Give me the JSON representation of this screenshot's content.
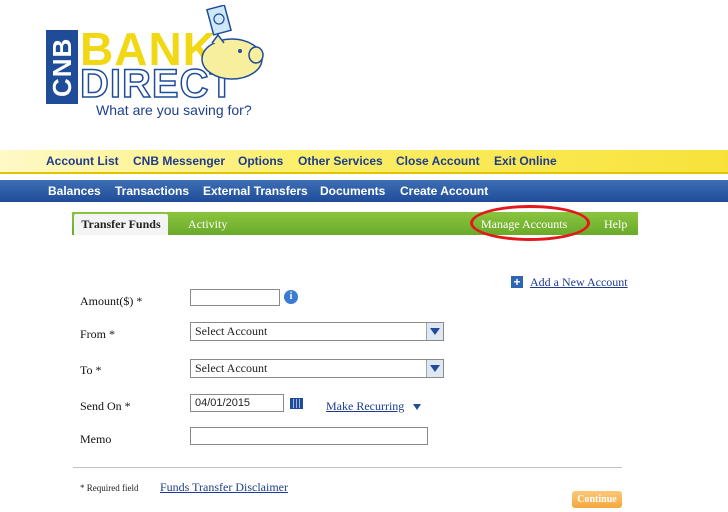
{
  "logo": {
    "cnb": "CNB",
    "bank": "BANK",
    "direct": "DIRECT",
    "tagline": "What are you saving for?"
  },
  "top_nav": [
    "Account List",
    "CNB Messenger",
    "Options",
    "Other Services",
    "Close Account",
    "Exit Online"
  ],
  "sub_nav": [
    "Balances",
    "Transactions",
    "External Transfers",
    "Documents",
    "Create Account"
  ],
  "tabs": {
    "transfer_funds": "Transfer Funds",
    "activity": "Activity",
    "manage_accounts": "Manage Accounts",
    "help": "Help"
  },
  "form": {
    "add_account_link": "Add a New Account",
    "amount_label": "Amount($) *",
    "amount_value": "",
    "from_label": "From *",
    "from_value": "Select Account",
    "to_label": "To *",
    "to_value": "Select Account",
    "send_on_label": "Send On *",
    "send_on_value": "04/01/2015",
    "make_recurring": "Make Recurring",
    "memo_label": "Memo",
    "memo_value": ""
  },
  "footer": {
    "required_note": "* Required field",
    "disclaimer_link": "Funds Transfer Disclaimer",
    "continue_label": "Continue"
  },
  "colors": {
    "nav_blue": "#1f4c99",
    "nav_yellow": "#f8e23a",
    "tab_green": "#7ab834",
    "highlight_red": "#e3181d",
    "continue_orange": "#f4a73b"
  }
}
